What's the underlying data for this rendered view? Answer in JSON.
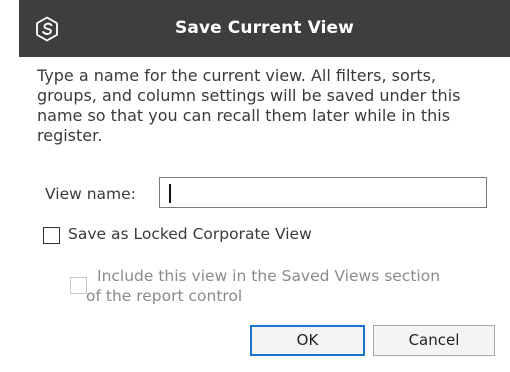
{
  "dialog": {
    "title": "Save Current View",
    "app_icon": "app-logo-icon",
    "title_bar_color": "#3e3e3e",
    "description_lines": [
      "Type a name for the current view.  All filters, sorts,",
      "groups, and column settings will be saved under this",
      "name so that you can recall them later while in this",
      "register."
    ],
    "view_name": {
      "label": "View name:",
      "value": ""
    },
    "locked_checkbox": {
      "label": "Save as Locked Corporate View",
      "checked": false
    },
    "include_checkbox": {
      "label_lines": [
        "Include this view in the Saved Views section",
        "of the report control"
      ],
      "checked": false,
      "enabled": false
    },
    "buttons": {
      "ok_label": "OK",
      "cancel_label": "Cancel",
      "accent_color": "#1a74d0"
    }
  }
}
